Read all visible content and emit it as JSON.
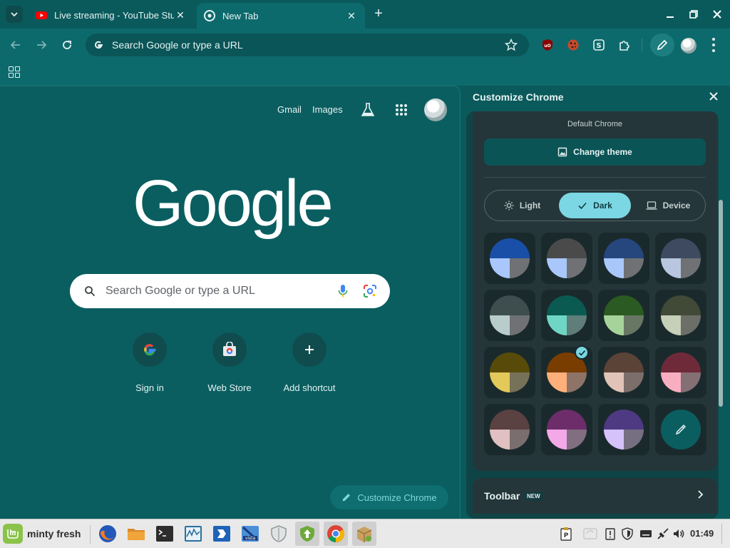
{
  "tabs": [
    {
      "title": "Live streaming - YouTube Studio",
      "favicon": "youtube-icon"
    },
    {
      "title": "New Tab",
      "favicon": "chrome-icon"
    }
  ],
  "omnibox": {
    "placeholder": "Search Google or type a URL"
  },
  "ntp": {
    "links": {
      "gmail": "Gmail",
      "images": "Images"
    },
    "logo": "Google",
    "search_placeholder": "Search Google or type a URL",
    "shortcuts": [
      {
        "label": "Sign in",
        "icon": "google-g-icon"
      },
      {
        "label": "Web Store",
        "icon": "web-store-icon"
      },
      {
        "label": "Add shortcut",
        "icon": "plus-icon"
      }
    ],
    "customize_button": "Customize Chrome"
  },
  "panel": {
    "title": "Customize Chrome",
    "default_label": "Default Chrome",
    "change_theme": "Change theme",
    "modes": {
      "light": "Light",
      "dark": "Dark",
      "device": "Device"
    },
    "selected_mode": "Dark",
    "swatches": [
      {
        "top": "#1a4fa8",
        "bl": "#a9c7fa",
        "br": "#6f7174"
      },
      {
        "top": "#4a4a4a",
        "bl": "#a9c7fa",
        "br": "#6f7174"
      },
      {
        "top": "#26467e",
        "bl": "#a9c7fa",
        "br": "#6f7174"
      },
      {
        "top": "#3d4a60",
        "bl": "#b9c6e0",
        "br": "#6f7174"
      },
      {
        "top": "#3e4d4d",
        "bl": "#b8cccc",
        "br": "#6f7174"
      },
      {
        "top": "#0a5a52",
        "bl": "#6fd6c6",
        "br": "#5f7d79"
      },
      {
        "top": "#2b5a22",
        "bl": "#a6d39a",
        "br": "#687764"
      },
      {
        "top": "#414937",
        "bl": "#c6cfb8",
        "br": "#6c6e68"
      },
      {
        "top": "#584b0a",
        "bl": "#e2c95a",
        "br": "#767159"
      },
      {
        "top": "#7a3d00",
        "bl": "#ffb07a",
        "br": "#8d7466",
        "selected": true
      },
      {
        "top": "#5b4338",
        "bl": "#e1c3b8",
        "br": "#7c6e6a"
      },
      {
        "top": "#6f2a3a",
        "bl": "#f7aec0",
        "br": "#846f74"
      },
      {
        "top": "#5a4142",
        "bl": "#e0c0c0",
        "br": "#7b6e6f"
      },
      {
        "top": "#6d2d6a",
        "bl": "#f3a8e8",
        "br": "#816e80"
      },
      {
        "top": "#4e3a82",
        "bl": "#d5c2fb",
        "br": "#766f82"
      },
      {
        "custom": true
      }
    ],
    "toolbar_row": {
      "label": "Toolbar",
      "badge": "NEW"
    }
  },
  "taskbar": {
    "menu_label": "minty fresh",
    "clock": "01:49",
    "apps": [
      "firefox-icon",
      "files-icon",
      "terminal-icon",
      "system-monitor-icon",
      "remote-desktop-icon",
      "vista-icon",
      "shield-icon",
      "update-manager-icon",
      "chrome-icon",
      "package-icon"
    ]
  }
}
